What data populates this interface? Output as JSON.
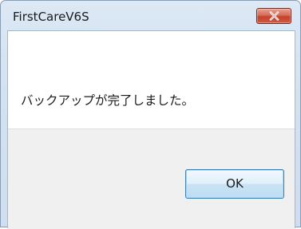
{
  "window": {
    "title": "FirstCareV6S",
    "close_icon": "close-icon"
  },
  "dialog": {
    "message": "バックアップが完了しました。",
    "ok_label": "OK"
  },
  "colors": {
    "close_button": "#c9452f",
    "title_bar": "#d6e4f2",
    "footer": "#f0f0f0",
    "ok_border": "#3c7fb1"
  }
}
